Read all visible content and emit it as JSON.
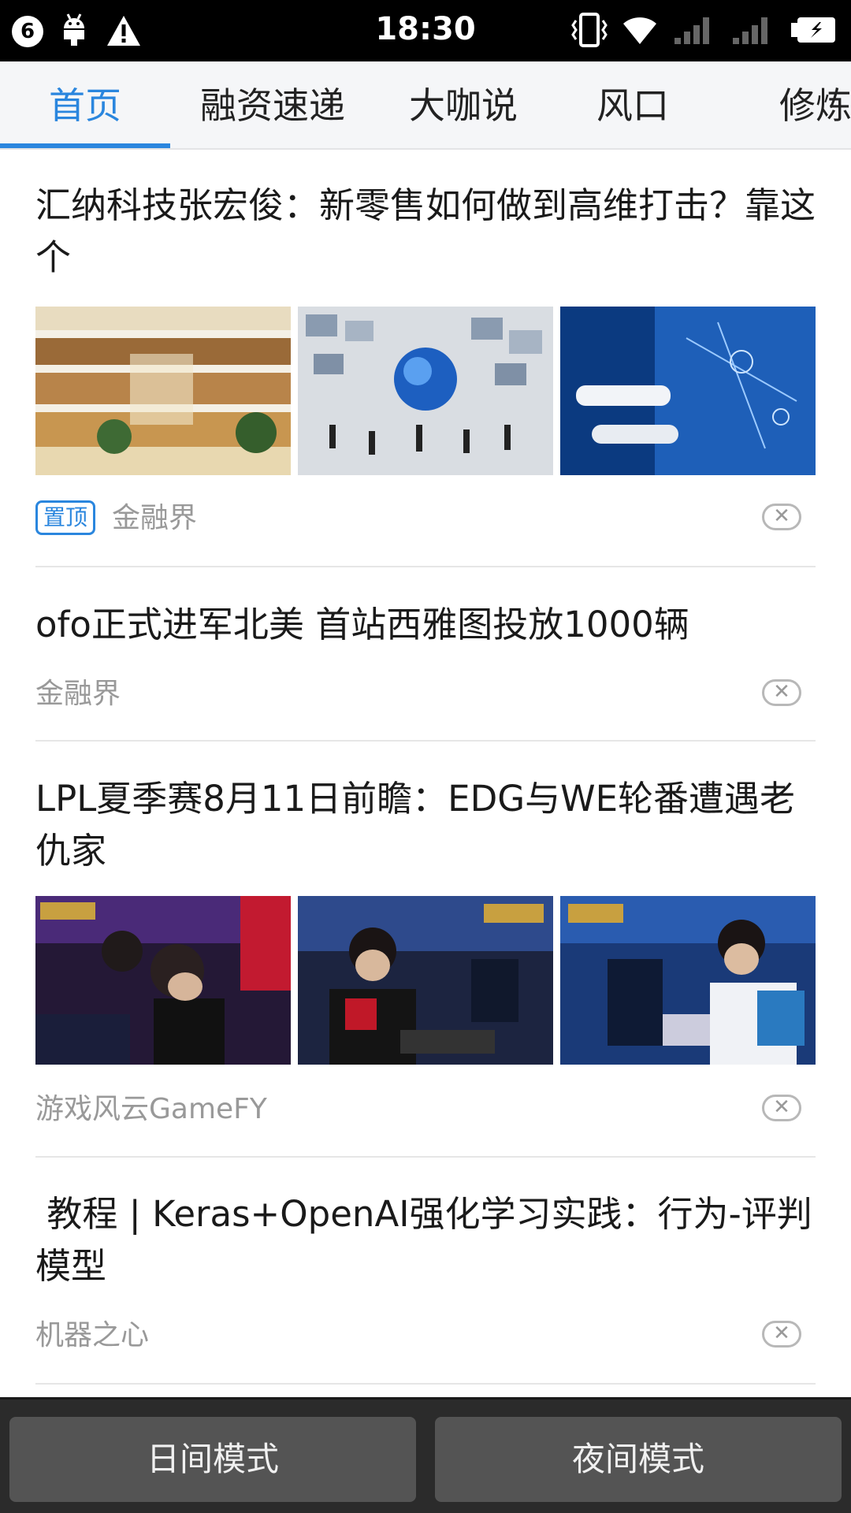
{
  "status_bar": {
    "badge_count": "6",
    "time": "18:30",
    "icons": [
      "notification-badge-icon",
      "android-debug-icon",
      "warning-icon",
      "vibrate-icon",
      "wifi-icon",
      "signal-icon",
      "signal-icon",
      "battery-charging-icon"
    ]
  },
  "tabs": [
    {
      "label": "首页",
      "active": true
    },
    {
      "label": "融资速递",
      "active": false
    },
    {
      "label": "大咖说",
      "active": false
    },
    {
      "label": "风口",
      "active": false
    },
    {
      "label": "修炼",
      "active": false
    }
  ],
  "colors": {
    "accent": "#2a86de",
    "source_text": "#999999",
    "mode_bar": "#2b2b2b",
    "mode_button": "#545454"
  },
  "articles": [
    {
      "title": "汇纳科技张宏俊：新零售如何做到高维打击？靠这个",
      "pinned_label": "置顶",
      "source": "金融界",
      "dismiss": "✕",
      "images": [
        "shopping-mall-atrium",
        "globe-network-crowd",
        "hands-touching-digital-network"
      ]
    },
    {
      "title": "ofo正式进军北美 首站西雅图投放1000辆",
      "source": "金融界",
      "dismiss": "✕"
    },
    {
      "title": "LPL夏季赛8月11日前瞻：EDG与WE轮番遭遇老仇家",
      "source": "游戏风云GameFY",
      "dismiss": "✕",
      "images": [
        "esports-players-edg",
        "esports-player-headset",
        "esports-players-blue-jersey"
      ]
    },
    {
      "title": " 教程 | Keras+OpenAI强化学习实践：行为-评判模型",
      "source": "机器之心",
      "dismiss": "✕"
    }
  ],
  "mode_bar": {
    "day_label": "日间模式",
    "night_label": "夜间模式"
  }
}
